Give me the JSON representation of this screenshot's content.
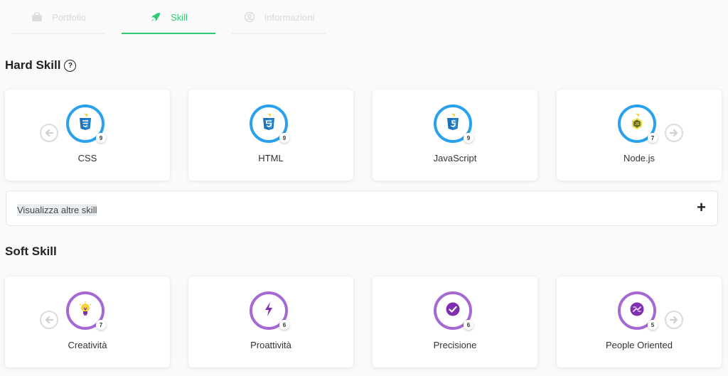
{
  "tabs": [
    {
      "label": "Portfolio",
      "icon": "briefcase-icon",
      "active": false
    },
    {
      "label": "Skill",
      "icon": "rocket-icon",
      "active": true
    },
    {
      "label": "Informazioni",
      "icon": "user-circle-icon",
      "active": false
    }
  ],
  "hard_skill": {
    "title": "Hard Skill",
    "help_icon": "question-icon",
    "items": [
      {
        "name": "CSS",
        "level": "9",
        "icon": "css3-icon"
      },
      {
        "name": "HTML",
        "level": "9",
        "icon": "html5-icon"
      },
      {
        "name": "JavaScript",
        "level": "9",
        "icon": "javascript-icon"
      },
      {
        "name": "Node.js",
        "level": "7",
        "icon": "nodejs-icon"
      }
    ]
  },
  "show_more": {
    "label": "Visualizza altre skill",
    "icon": "plus-icon"
  },
  "soft_skill": {
    "title": "Soft Skill",
    "items": [
      {
        "name": "Creatività",
        "level": "7",
        "icon": "lightbulb-icon"
      },
      {
        "name": "Proattività",
        "level": "6",
        "icon": "lightning-icon"
      },
      {
        "name": "Precisione",
        "level": "6",
        "icon": "check-circle-icon"
      },
      {
        "name": "People Oriented",
        "level": "5",
        "icon": "handshake-icon"
      }
    ]
  },
  "colors": {
    "accent": "#2ecc71",
    "hard_ring": "#2aa1ec",
    "soft_ring": "#a569d1",
    "soft_icon": "#7e2fb0"
  }
}
